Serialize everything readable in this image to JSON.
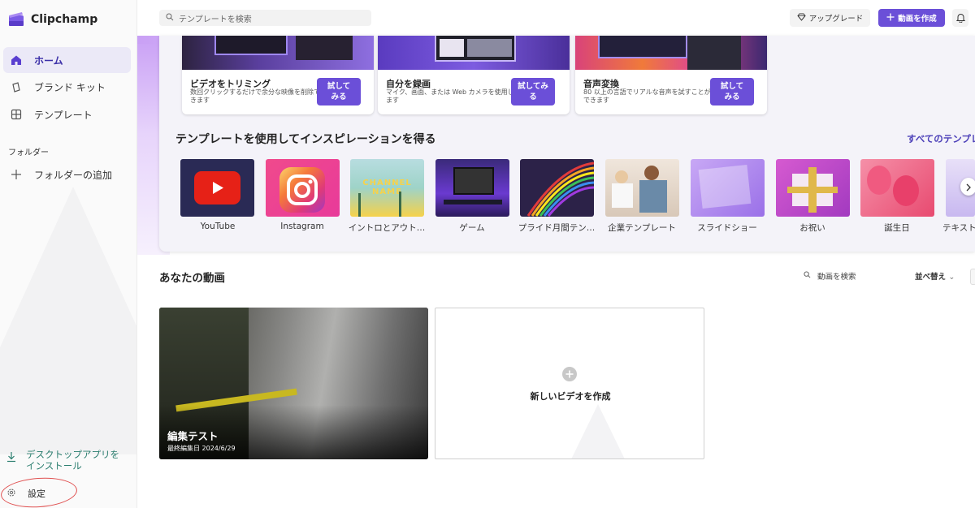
{
  "app": {
    "name": "Clipchamp"
  },
  "sidebar": {
    "items": [
      {
        "label": "ホーム"
      },
      {
        "label": "ブランド キット"
      },
      {
        "label": "テンプレート"
      }
    ],
    "folder_heading": "フォルダー",
    "add_folder": "フォルダーの追加",
    "install_line1": "デスクトップアプリを",
    "install_line2": "インストール",
    "settings": "設定"
  },
  "topbar": {
    "search_placeholder": "テンプレートを検索",
    "upgrade": "アップグレード",
    "create": "動画を作成"
  },
  "promos": [
    {
      "title": "ビデオをトリミング",
      "desc": "数回クリックするだけで余分な映像を削除できます",
      "button_line1": "試して",
      "button_line2": "みる"
    },
    {
      "title": "自分を録画",
      "desc": "マイク、画面、または Web カメラを使用します",
      "button_line1": "試してみ",
      "button_line2": "る"
    },
    {
      "title": "音声変換",
      "desc": "80 以上の言語でリアルな音声を試すことができます",
      "button_line1": "試して",
      "button_line2": "みる"
    }
  ],
  "templates_section": {
    "title": "テンプレートを使用してインスピレーションを得る",
    "see_all": "すべてのテンプレ",
    "items": [
      {
        "label": "YouTube"
      },
      {
        "label": "Instagram"
      },
      {
        "label": "イントロとアウト…"
      },
      {
        "label": "ゲーム"
      },
      {
        "label": "プライド月間テン…"
      },
      {
        "label": "企業テンプレート"
      },
      {
        "label": "スライドショー"
      },
      {
        "label": "お祝い"
      },
      {
        "label": "誕生日"
      },
      {
        "label": "テキスト"
      }
    ],
    "intro_overlay": "CHANNEL NAME"
  },
  "videos_section": {
    "title": "あなたの動画",
    "search_placeholder": "動画を検索",
    "sort": "並べ替え",
    "video": {
      "title": "編集テスト",
      "meta": "最終編集日 2024/6/29"
    },
    "new_video": "新しいビデオを作成"
  },
  "colors": {
    "accent": "#6b4fd8",
    "link": "#4b3fb8",
    "install": "#2a7d6e"
  }
}
